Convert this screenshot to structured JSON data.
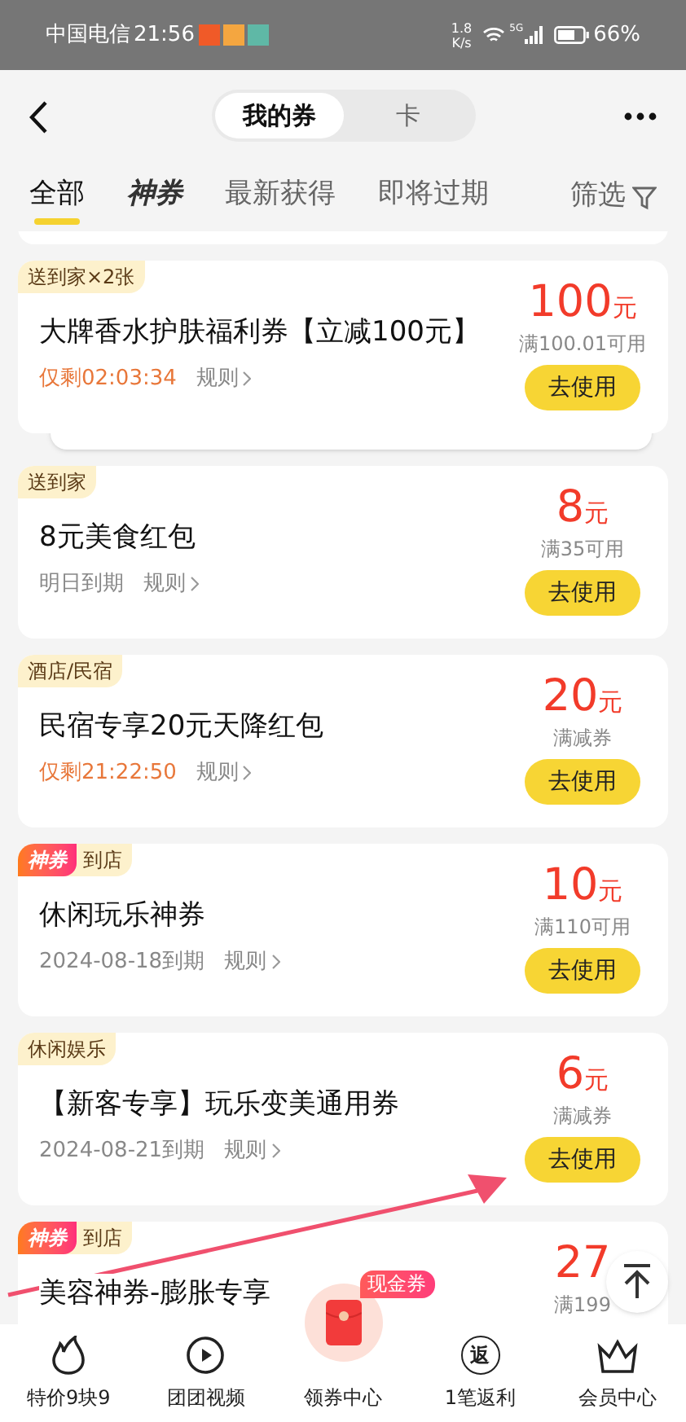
{
  "status_bar": {
    "carrier": "中国电信",
    "time": "21:56",
    "speed_value": "1.8",
    "speed_unit": "K/s",
    "network": "5G",
    "battery": "66%"
  },
  "header": {
    "segments": [
      {
        "label": "我的券",
        "selected": true
      },
      {
        "label": "卡",
        "selected": false
      }
    ]
  },
  "filter_tabs": [
    {
      "label": "全部",
      "selected": true,
      "kind": "text"
    },
    {
      "label": "神券",
      "selected": false,
      "kind": "brand"
    },
    {
      "label": "最新获得",
      "selected": false,
      "kind": "text"
    },
    {
      "label": "即将过期",
      "selected": false,
      "kind": "text"
    }
  ],
  "filter_button": "筛选",
  "coupons": [
    {
      "tags": [
        {
          "label": "送到家×2张",
          "kind": "category"
        }
      ],
      "title": "大牌香水护肤福利券【立减100元】",
      "expiry": "仅剩02:03:34",
      "expiring_soon": true,
      "rules": "规则",
      "amount": "100",
      "unit": "元",
      "condition": "满100.01可用",
      "button": "去使用",
      "stacked": true
    },
    {
      "tags": [
        {
          "label": "送到家",
          "kind": "category"
        }
      ],
      "title": "8元美食红包",
      "expiry": "明日到期",
      "expiring_soon": false,
      "rules": "规则",
      "amount": "8",
      "unit": "元",
      "condition": "满35可用",
      "button": "去使用",
      "stacked": false
    },
    {
      "tags": [
        {
          "label": "酒店/民宿",
          "kind": "category"
        }
      ],
      "title": "民宿专享20元天降红包",
      "expiry": "仅剩21:22:50",
      "expiring_soon": true,
      "rules": "规则",
      "amount": "20",
      "unit": "元",
      "condition": "满减券",
      "button": "去使用",
      "stacked": false
    },
    {
      "tags": [
        {
          "label": "神券",
          "kind": "special"
        },
        {
          "label": "到店",
          "kind": "category"
        }
      ],
      "title": "休闲玩乐神券",
      "expiry": "2024-08-18到期",
      "expiring_soon": false,
      "rules": "规则",
      "amount": "10",
      "unit": "元",
      "condition": "满110可用",
      "button": "去使用",
      "stacked": false
    },
    {
      "tags": [
        {
          "label": "休闲娱乐",
          "kind": "category"
        }
      ],
      "title": "【新客专享】玩乐变美通用券",
      "expiry": "2024-08-21到期",
      "expiring_soon": false,
      "rules": "规则",
      "amount": "6",
      "unit": "元",
      "condition": "满减券",
      "button": "去使用",
      "stacked": false
    },
    {
      "tags": [
        {
          "label": "神券",
          "kind": "special"
        },
        {
          "label": "到店",
          "kind": "category"
        }
      ],
      "title": "美容神券-膨胀专享",
      "amount": "27",
      "condition": "满199",
      "stacked": false
    }
  ],
  "nav": [
    {
      "label": "特价9块9",
      "kind": "flame"
    },
    {
      "label": "团团视频",
      "kind": "play"
    },
    {
      "label": "领券中心",
      "kind": "center",
      "badge": "现金券"
    },
    {
      "label": "1笔返利",
      "kind": "rebate",
      "glyph": "返"
    },
    {
      "label": "会员中心",
      "kind": "crown"
    }
  ]
}
